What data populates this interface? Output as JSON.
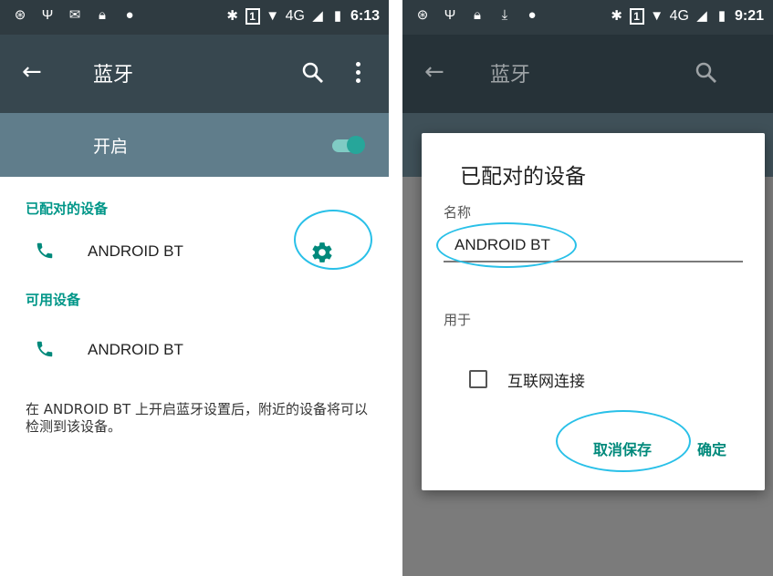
{
  "left": {
    "statusbar": {
      "time": "6:13",
      "network": "4G",
      "sim": "1"
    },
    "toolbar": {
      "title": "蓝牙"
    },
    "switch": {
      "label": "开启",
      "on": true
    },
    "paired": {
      "header": "已配对的设备",
      "devices": [
        {
          "name": "ANDROID BT"
        }
      ]
    },
    "available": {
      "header": "可用设备",
      "devices": [
        {
          "name": "ANDROID BT"
        }
      ]
    },
    "hint": "在 ANDROID BT 上开启蓝牙设置后，附近的设备将可以检测到该设备。"
  },
  "right": {
    "statusbar": {
      "time": "9:21",
      "network": "4G",
      "sim": "1"
    },
    "toolbar": {
      "title": "蓝牙"
    },
    "dialog": {
      "title": "已配对的设备",
      "name_label": "名称",
      "name_value": "ANDROID BT",
      "use_label": "用于",
      "checkbox_label": "互联网连接",
      "checkbox_checked": false,
      "cancel_button": "取消保存",
      "ok_button": "确定"
    }
  },
  "colors": {
    "statusbar": "#2f3b41",
    "toolbar": "#37474f",
    "switchbar": "#607d8b",
    "accent": "#009688",
    "annotation": "#29c0e8"
  },
  "icons": [
    "back-arrow-icon",
    "search-icon",
    "more-vert-icon",
    "phone-icon",
    "gear-icon",
    "bluetooth-icon",
    "signal-icon",
    "battery-icon"
  ]
}
